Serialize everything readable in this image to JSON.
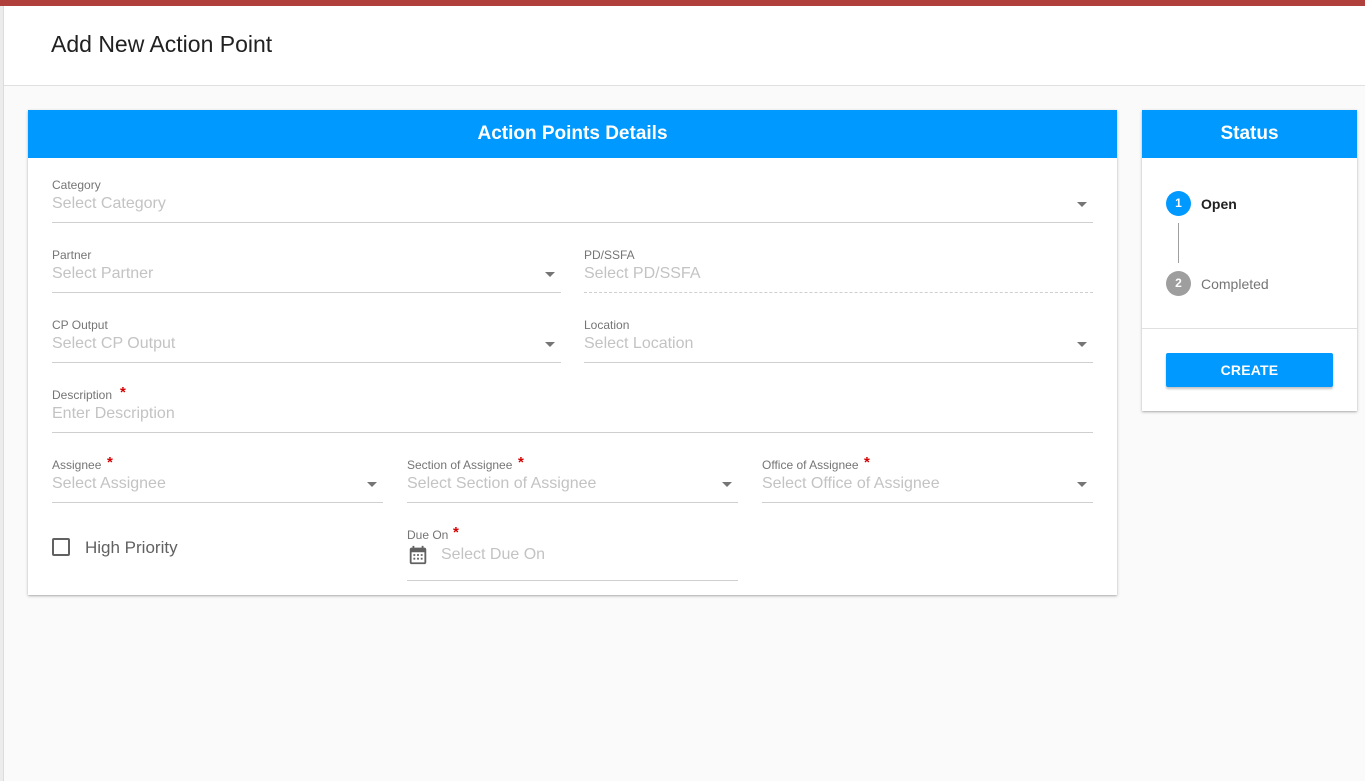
{
  "page": {
    "title": "Add New Action Point"
  },
  "details": {
    "header": "Action Points Details",
    "category": {
      "label": "Category",
      "placeholder": "Select Category"
    },
    "partner": {
      "label": "Partner",
      "placeholder": "Select Partner"
    },
    "pd_ssfa": {
      "label": "PD/SSFA",
      "placeholder": "Select PD/SSFA"
    },
    "cp_output": {
      "label": "CP Output",
      "placeholder": "Select CP Output"
    },
    "location": {
      "label": "Location",
      "placeholder": "Select Location"
    },
    "description": {
      "label": "Description",
      "placeholder": "Enter Description",
      "required_mark": "*"
    },
    "assignee": {
      "label": "Assignee",
      "placeholder": "Select Assignee",
      "required_mark": "*"
    },
    "section": {
      "label": "Section of Assignee",
      "placeholder": "Select Section of Assignee",
      "required_mark": "*"
    },
    "office": {
      "label": "Office of Assignee",
      "placeholder": "Select Office of Assignee",
      "required_mark": "*"
    },
    "high_priority": {
      "label": "High Priority",
      "checked": false
    },
    "due_on": {
      "label": "Due On",
      "placeholder": "Select Due On",
      "required_mark": "*",
      "icon": "calendar-icon"
    }
  },
  "status": {
    "header": "Status",
    "steps": [
      {
        "number": "1",
        "label": "Open",
        "active": true
      },
      {
        "number": "2",
        "label": "Completed",
        "active": false
      }
    ],
    "create_label": "CREATE"
  },
  "colors": {
    "accent": "#0099ff",
    "top_bar": "#b0403c",
    "required": "#d50000",
    "inactive_step": "#9e9e9e"
  }
}
